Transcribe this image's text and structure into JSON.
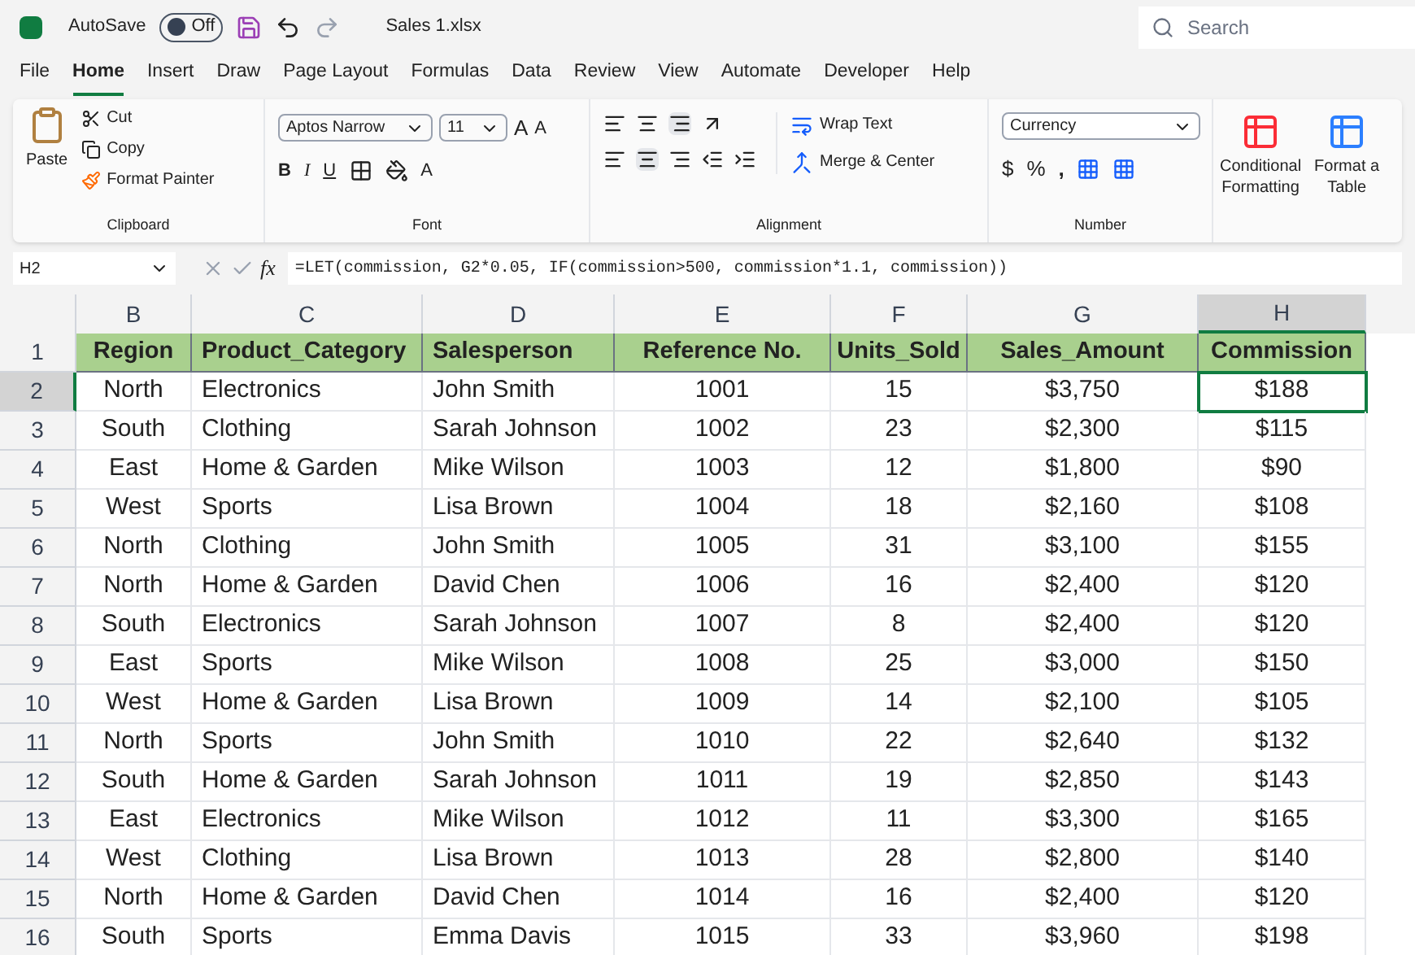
{
  "title_bar": {
    "autosave_label": "AutoSave",
    "autosave": {
      "label": "Off",
      "on": false
    },
    "file_name": "Sales 1.xlsx",
    "search_placeholder": "Search"
  },
  "tabs": [
    {
      "label": "File",
      "selected": false
    },
    {
      "label": "Home",
      "selected": true
    },
    {
      "label": "Insert",
      "selected": false
    },
    {
      "label": "Draw",
      "selected": false
    },
    {
      "label": "Page Layout",
      "selected": false
    },
    {
      "label": "Formulas",
      "selected": false
    },
    {
      "label": "Data",
      "selected": false
    },
    {
      "label": "Review",
      "selected": false
    },
    {
      "label": "View",
      "selected": false
    },
    {
      "label": "Automate",
      "selected": false
    },
    {
      "label": "Developer",
      "selected": false
    },
    {
      "label": "Help",
      "selected": false
    }
  ],
  "ribbon": {
    "clipboard": {
      "paste": "Paste",
      "cut": "Cut",
      "copy": "Copy",
      "format_painter": "Format Painter",
      "label": "Clipboard"
    },
    "font": {
      "name": "Aptos Narrow",
      "size": "11",
      "grow": "A",
      "shrink": "A",
      "bold": "B",
      "italic": "I",
      "underline": "U",
      "font_color_label": "A",
      "label": "Font"
    },
    "alignment": {
      "wrap": "Wrap Text",
      "merge": "Merge & Center",
      "label": "Alignment"
    },
    "number": {
      "format": "Currency",
      "currency": "$",
      "percent": "%",
      "comma": ",",
      "label": "Number"
    },
    "styles": [
      {
        "line1": "Conditional",
        "line2": "Formatting"
      },
      {
        "line1": "Format a",
        "line2": "Table"
      }
    ]
  },
  "formula_bar": {
    "name_box": "H2",
    "fx": "fx",
    "formula": "=LET(commission, G2*0.05, IF(commission>500, commission*1.1, commission))"
  },
  "columns": [
    {
      "letter": "B",
      "selected": false
    },
    {
      "letter": "C",
      "selected": false
    },
    {
      "letter": "D",
      "selected": false
    },
    {
      "letter": "E",
      "selected": false
    },
    {
      "letter": "F",
      "selected": false
    },
    {
      "letter": "G",
      "selected": false
    },
    {
      "letter": "H",
      "selected": true
    }
  ],
  "rows": [
    {
      "number": "1",
      "selected": false,
      "kind": "header",
      "cells": [
        "Region",
        "Product_Category",
        "Salesperson",
        "Reference No.",
        "Units_Sold",
        "Sales_Amount",
        "Commission"
      ]
    },
    {
      "number": "2",
      "selected": true,
      "kind": "data",
      "cells": [
        "North",
        "Electronics",
        "John Smith",
        "1001",
        "15",
        "$3,750",
        "$188"
      ]
    },
    {
      "number": "3",
      "selected": false,
      "kind": "data",
      "cells": [
        "South",
        "Clothing",
        "Sarah Johnson",
        "1002",
        "23",
        "$2,300",
        "$115"
      ]
    },
    {
      "number": "4",
      "selected": false,
      "kind": "data",
      "cells": [
        "East",
        "Home & Garden",
        "Mike Wilson",
        "1003",
        "12",
        "$1,800",
        "$90"
      ]
    },
    {
      "number": "5",
      "selected": false,
      "kind": "data",
      "cells": [
        "West",
        "Sports",
        "Lisa Brown",
        "1004",
        "18",
        "$2,160",
        "$108"
      ]
    },
    {
      "number": "6",
      "selected": false,
      "kind": "data",
      "cells": [
        "North",
        "Clothing",
        "John Smith",
        "1005",
        "31",
        "$3,100",
        "$155"
      ]
    },
    {
      "number": "7",
      "selected": false,
      "kind": "data",
      "cells": [
        "North",
        "Home & Garden",
        "David Chen",
        "1006",
        "16",
        "$2,400",
        "$120"
      ]
    },
    {
      "number": "8",
      "selected": false,
      "kind": "data",
      "cells": [
        "South",
        "Electronics",
        "Sarah Johnson",
        "1007",
        "8",
        "$2,400",
        "$120"
      ]
    },
    {
      "number": "9",
      "selected": false,
      "kind": "data",
      "cells": [
        "East",
        "Sports",
        "Mike Wilson",
        "1008",
        "25",
        "$3,000",
        "$150"
      ]
    },
    {
      "number": "10",
      "selected": false,
      "kind": "data",
      "cells": [
        "West",
        "Home & Garden",
        "Lisa Brown",
        "1009",
        "14",
        "$2,100",
        "$105"
      ]
    },
    {
      "number": "11",
      "selected": false,
      "kind": "data",
      "cells": [
        "North",
        "Sports",
        "John Smith",
        "1010",
        "22",
        "$2,640",
        "$132"
      ]
    },
    {
      "number": "12",
      "selected": false,
      "kind": "data",
      "cells": [
        "South",
        "Home & Garden",
        "Sarah Johnson",
        "1011",
        "19",
        "$2,850",
        "$143"
      ]
    },
    {
      "number": "13",
      "selected": false,
      "kind": "data",
      "cells": [
        "East",
        "Electronics",
        "Mike Wilson",
        "1012",
        "11",
        "$3,300",
        "$165"
      ]
    },
    {
      "number": "14",
      "selected": false,
      "kind": "data",
      "cells": [
        "West",
        "Clothing",
        "Lisa Brown",
        "1013",
        "28",
        "$2,800",
        "$140"
      ]
    },
    {
      "number": "15",
      "selected": false,
      "kind": "data",
      "cells": [
        "North",
        "Home & Garden",
        "David Chen",
        "1014",
        "16",
        "$2,400",
        "$120"
      ]
    },
    {
      "number": "16",
      "selected": false,
      "kind": "data",
      "cells": [
        "South",
        "Sports",
        "Emma Davis",
        "1015",
        "33",
        "$3,960",
        "$198"
      ]
    }
  ]
}
